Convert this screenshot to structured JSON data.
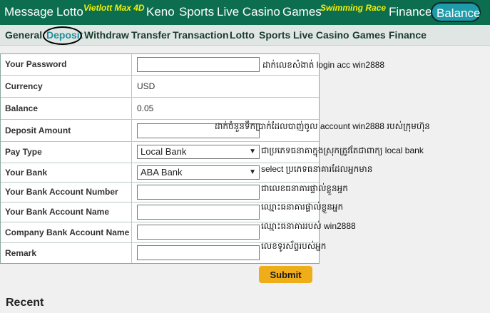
{
  "topnav": {
    "items": [
      "Message",
      "Lotto",
      "Keno",
      "Sports",
      "Live Casino",
      "Games",
      "Finance",
      "Balance"
    ],
    "promos": [
      "Vietlott Max 4D",
      "Swimming Race"
    ]
  },
  "subnav": {
    "items": [
      "General",
      "Deposit",
      "Withdraw",
      "Transfer",
      "Transaction",
      "Lotto",
      "Sports",
      "Live Casino",
      "Games",
      "Finance"
    ]
  },
  "form": {
    "password_label": "Your Password",
    "currency_label": "Currency",
    "currency_value": "USD",
    "balance_label": "Balance",
    "balance_value": "0.05",
    "amount_label": "Deposit Amount",
    "paytype_label": "Pay Type",
    "paytype_value": "Local Bank",
    "bank_label": "Your Bank",
    "bank_value": "ABA Bank",
    "acctnum_label": "Your Bank Account Number",
    "acctname_label": "Your Bank Account Name",
    "company_label": "Company Bank Account Name",
    "remark_label": "Remark"
  },
  "notes": {
    "password": "ដាក់លេខសំងាត់ login acc win2888",
    "amount": "ដាក់ចំនួនទឹកប្រាក់ដែលបាញ់ចូល account win2888 របស់ក្រុមហ៊ុន",
    "paytype": "ជាប្រភេទធនាគាក្នុងស្រុកត្រូវតែជាពាក្យ local bank",
    "bank": "select ប្រភេទធនាគារដែលអ្នកមាន",
    "acctnum": "ជាលេខធនាគារផ្ទាល់ខ្លួនអ្នក",
    "acctname": "ឈ្មោះធនាគារផ្ទាល់ខ្លួនអ្នក",
    "company": "ឈ្មោះធនាគាររបស់ win2888",
    "remark": "លេខទូរស័ព្ទរបស់អ្នក"
  },
  "submit_label": "Submit",
  "recent_label": "Recent"
}
